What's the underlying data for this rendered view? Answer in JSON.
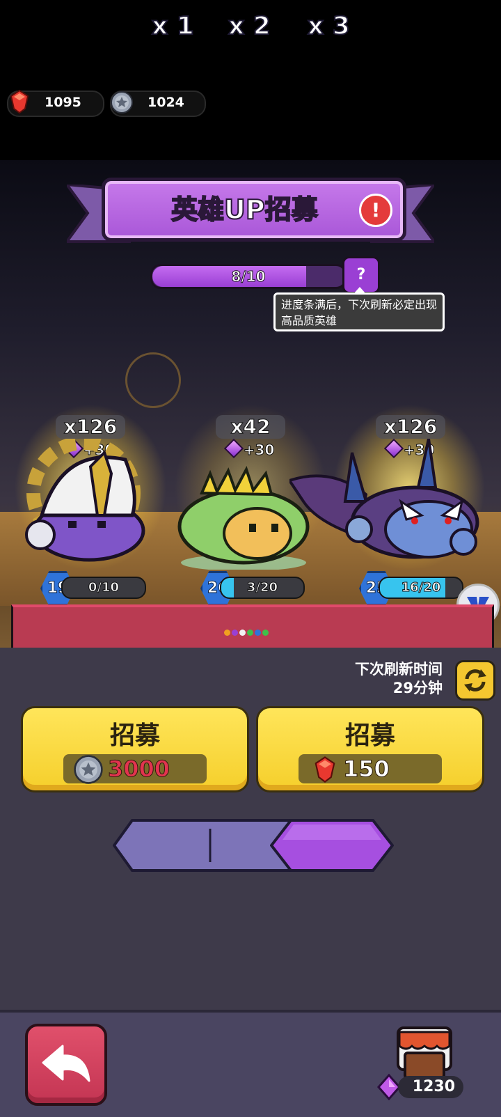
{
  "currency": {
    "gems": "1095",
    "coins": "1024"
  },
  "banner": {
    "title": "英雄UP招募"
  },
  "progress": {
    "text": "8/10",
    "fraction": 0.8,
    "help_label": "?",
    "tooltip": "进度条满后，下次刷新必定出现高品质英雄"
  },
  "heroes": [
    {
      "count": "x126",
      "bonus": "+30",
      "level": "19",
      "shards": "0/10",
      "fill": 0.0
    },
    {
      "count": "x42",
      "bonus": "+30",
      "level": "26",
      "shards": "3/20",
      "fill": 0.15
    },
    {
      "count": "x126",
      "bonus": "+30",
      "level": "25",
      "shards": "16/20",
      "fill": 0.8
    }
  ],
  "refresh": {
    "label": "下次刷新时间",
    "time": "29分钟"
  },
  "recruit": [
    {
      "title": "招募",
      "cost": "3000",
      "currency": "coin",
      "cost_color": "#e2344f"
    },
    {
      "title": "招募",
      "cost": "150",
      "currency": "gem",
      "cost_color": "#ffffff"
    }
  ],
  "multipliers": [
    "x 1",
    "x 2",
    "x 3"
  ],
  "selected_multiplier": "x 3",
  "shop": {
    "purple_gems": "1230"
  },
  "colors": {
    "accent_purple": "#a957d8",
    "button_yellow": "#f5cf2b",
    "back_red": "#c43553",
    "level_blue": "#2f73d9",
    "shard_cyan": "#37c4ee"
  },
  "icons": [
    "gem-icon",
    "coin-icon",
    "alert-icon",
    "help-icon",
    "refresh-icon",
    "back-arrow-icon",
    "shop-icon",
    "purple-gem-icon",
    "v-badge-icon"
  ]
}
